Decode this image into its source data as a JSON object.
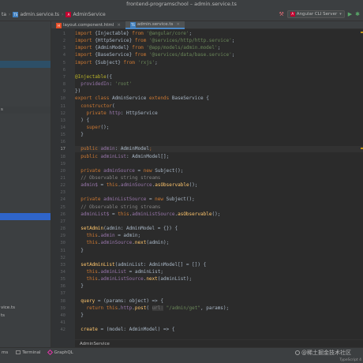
{
  "window_title": "frontend-programschool – admin.service.ts",
  "navbar": {
    "crumbs": [
      {
        "label": "ta",
        "icon": "none"
      },
      {
        "label": "admin.service.ts",
        "icon": "typescript-file-icon"
      },
      {
        "label": "AdminService",
        "icon": "angular-icon"
      }
    ],
    "run_config": "Angular CLI Server"
  },
  "project_rows": [
    {
      "label": "",
      "hl": ""
    },
    {
      "label": "",
      "hl": ""
    },
    {
      "label": "",
      "hl": ""
    },
    {
      "label": "",
      "hl": ""
    },
    {
      "label": "",
      "hl": ""
    },
    {
      "label": "",
      "hl": "hl1"
    },
    {
      "label": "",
      "hl": ""
    },
    {
      "label": "",
      "hl": ""
    },
    {
      "label": "",
      "hl": ""
    },
    {
      "label": "",
      "hl": ""
    },
    {
      "label": "",
      "hl": ""
    },
    {
      "label": "s",
      "hl": "hl3"
    },
    {
      "label": "",
      "hl": ""
    },
    {
      "label": "",
      "hl": ""
    },
    {
      "label": "",
      "hl": ""
    },
    {
      "label": "",
      "hl": ""
    },
    {
      "label": "",
      "hl": ""
    },
    {
      "label": "",
      "hl": ""
    },
    {
      "label": "",
      "hl": ""
    },
    {
      "label": "",
      "hl": ""
    },
    {
      "label": "",
      "hl": ""
    },
    {
      "label": "",
      "hl": ""
    },
    {
      "label": "",
      "hl": ""
    },
    {
      "label": "",
      "hl": ""
    },
    {
      "label": "",
      "hl": ""
    },
    {
      "label": "",
      "hl": "hl2"
    },
    {
      "label": "",
      "hl": ""
    },
    {
      "label": "",
      "hl": ""
    },
    {
      "label": "",
      "hl": ""
    },
    {
      "label": "",
      "hl": ""
    },
    {
      "label": "",
      "hl": ""
    },
    {
      "label": "",
      "hl": ""
    },
    {
      "label": "",
      "hl": ""
    },
    {
      "label": "",
      "hl": ""
    },
    {
      "label": "",
      "hl": ""
    },
    {
      "label": "",
      "hl": ""
    },
    {
      "label": "",
      "hl": ""
    },
    {
      "label": "vice.ts",
      "hl": ""
    },
    {
      "label": "ts",
      "hl": ""
    }
  ],
  "tabs": [
    {
      "label": "layout.component.html",
      "icon": "html-file-icon",
      "active": false
    },
    {
      "label": "admin.service.ts",
      "icon": "typescript-file-icon",
      "active": true
    }
  ],
  "code_lines": [
    {
      "n": "1",
      "t": [
        [
          "k",
          "import "
        ],
        [
          "p",
          "{"
        ],
        [
          "p",
          "Injectable"
        ],
        [
          "p",
          "} "
        ],
        [
          "k",
          "from "
        ],
        [
          "s",
          "'@angular/core'"
        ],
        [
          "p",
          ";"
        ]
      ]
    },
    {
      "n": "2",
      "t": [
        [
          "k",
          "import "
        ],
        [
          "p",
          "{HttpService} "
        ],
        [
          "k",
          "from "
        ],
        [
          "s",
          "'@services/http/http.service'"
        ],
        [
          "p",
          ";"
        ]
      ]
    },
    {
      "n": "3",
      "t": [
        [
          "k",
          "import "
        ],
        [
          "p",
          "{AdminModel} "
        ],
        [
          "k",
          "from "
        ],
        [
          "s",
          "'@app/models/admin.model'"
        ],
        [
          "p",
          ";"
        ]
      ]
    },
    {
      "n": "4",
      "t": [
        [
          "k",
          "import "
        ],
        [
          "p",
          "{BaseService} "
        ],
        [
          "k",
          "from "
        ],
        [
          "s",
          "'@services/data/base.service'"
        ],
        [
          "p",
          ";"
        ]
      ]
    },
    {
      "n": "5",
      "t": [
        [
          "k",
          "import "
        ],
        [
          "p",
          "{Subject} "
        ],
        [
          "k",
          "from "
        ],
        [
          "s",
          "'rxjs'"
        ],
        [
          "p",
          ";"
        ]
      ]
    },
    {
      "n": "6",
      "t": []
    },
    {
      "n": "7",
      "t": [
        [
          "a",
          "@Injectable"
        ],
        [
          "p",
          "({"
        ]
      ]
    },
    {
      "n": "8",
      "t": [
        [
          "p",
          "  "
        ],
        [
          "f",
          "providedIn"
        ],
        [
          "p",
          ": "
        ],
        [
          "s",
          "'root'"
        ]
      ]
    },
    {
      "n": "9",
      "t": [
        [
          "p",
          "})"
        ]
      ]
    },
    {
      "n": "10",
      "t": [
        [
          "k",
          "export class "
        ],
        [
          "p",
          "AdminService "
        ],
        [
          "k",
          "extends "
        ],
        [
          "p",
          "BaseService {"
        ]
      ]
    },
    {
      "n": "11",
      "t": [
        [
          "p",
          "  "
        ],
        [
          "k",
          "constructor"
        ],
        [
          "p",
          "("
        ]
      ]
    },
    {
      "n": "12",
      "t": [
        [
          "p",
          "    "
        ],
        [
          "k",
          "private "
        ],
        [
          "f",
          "http"
        ],
        [
          "p",
          ": HttpService"
        ]
      ]
    },
    {
      "n": "13",
      "t": [
        [
          "p",
          "  ) {"
        ]
      ]
    },
    {
      "n": "14",
      "t": [
        [
          "p",
          "    "
        ],
        [
          "k",
          "super"
        ],
        [
          "p",
          "();"
        ]
      ]
    },
    {
      "n": "15",
      "t": [
        [
          "p",
          "  }"
        ]
      ]
    },
    {
      "n": "16",
      "t": []
    },
    {
      "n": "17",
      "t": [
        [
          "p",
          "  "
        ],
        [
          "k",
          "public "
        ],
        [
          "f",
          "admin"
        ],
        [
          "p",
          ": AdminModel"
        ],
        [
          "k",
          ";"
        ]
      ],
      "cur": true
    },
    {
      "n": "18",
      "t": [
        [
          "p",
          "  "
        ],
        [
          "k",
          "public "
        ],
        [
          "f",
          "adminList"
        ],
        [
          "p",
          ": AdminModel[];"
        ]
      ]
    },
    {
      "n": "19",
      "t": []
    },
    {
      "n": "20",
      "t": [
        [
          "p",
          "  "
        ],
        [
          "k",
          "private "
        ],
        [
          "f",
          "adminSource"
        ],
        [
          "p",
          " = "
        ],
        [
          "k",
          "new "
        ],
        [
          "p",
          "Subject();"
        ]
      ]
    },
    {
      "n": "21",
      "t": [
        [
          "c",
          "  // Observable string streams"
        ]
      ]
    },
    {
      "n": "22",
      "t": [
        [
          "p",
          "  "
        ],
        [
          "f",
          "admin$"
        ],
        [
          "p",
          " = "
        ],
        [
          "k",
          "this"
        ],
        [
          "p",
          "."
        ],
        [
          "f",
          "adminSource"
        ],
        [
          "p",
          "."
        ],
        [
          "m",
          "asObservable"
        ],
        [
          "p",
          "();"
        ]
      ]
    },
    {
      "n": "23",
      "t": []
    },
    {
      "n": "24",
      "t": [
        [
          "p",
          "  "
        ],
        [
          "k",
          "private "
        ],
        [
          "f",
          "adminListSource"
        ],
        [
          "p",
          " = "
        ],
        [
          "k",
          "new "
        ],
        [
          "p",
          "Subject();"
        ]
      ]
    },
    {
      "n": "25",
      "t": [
        [
          "c",
          "  // Observable string streams"
        ]
      ]
    },
    {
      "n": "26",
      "t": [
        [
          "p",
          "  "
        ],
        [
          "f",
          "adminList$"
        ],
        [
          "p",
          " = "
        ],
        [
          "k",
          "this"
        ],
        [
          "p",
          "."
        ],
        [
          "f",
          "adminListSource"
        ],
        [
          "p",
          "."
        ],
        [
          "m",
          "asObservable"
        ],
        [
          "p",
          "();"
        ]
      ]
    },
    {
      "n": "27",
      "t": []
    },
    {
      "n": "28",
      "t": [
        [
          "p",
          "  "
        ],
        [
          "m",
          "setAdmin"
        ],
        [
          "p",
          "(admin: AdminModel = {}) {"
        ]
      ]
    },
    {
      "n": "29",
      "t": [
        [
          "p",
          "    "
        ],
        [
          "k",
          "this"
        ],
        [
          "p",
          "."
        ],
        [
          "f",
          "admin"
        ],
        [
          "p",
          " = admin;"
        ]
      ]
    },
    {
      "n": "30",
      "t": [
        [
          "p",
          "    "
        ],
        [
          "k",
          "this"
        ],
        [
          "p",
          "."
        ],
        [
          "f",
          "adminSource"
        ],
        [
          "p",
          "."
        ],
        [
          "m",
          "next"
        ],
        [
          "p",
          "(admin);"
        ]
      ]
    },
    {
      "n": "31",
      "t": [
        [
          "p",
          "  }"
        ]
      ]
    },
    {
      "n": "32",
      "t": []
    },
    {
      "n": "33",
      "t": [
        [
          "p",
          "  "
        ],
        [
          "m",
          "setAdminList"
        ],
        [
          "p",
          "(adminList: AdminModel[] = []) {"
        ]
      ]
    },
    {
      "n": "34",
      "t": [
        [
          "p",
          "    "
        ],
        [
          "k",
          "this"
        ],
        [
          "p",
          "."
        ],
        [
          "f",
          "adminList"
        ],
        [
          "p",
          " = adminList;"
        ]
      ]
    },
    {
      "n": "35",
      "t": [
        [
          "p",
          "    "
        ],
        [
          "k",
          "this"
        ],
        [
          "p",
          "."
        ],
        [
          "f",
          "adminListSource"
        ],
        [
          "p",
          "."
        ],
        [
          "m",
          "next"
        ],
        [
          "p",
          "(adminList);"
        ]
      ]
    },
    {
      "n": "36",
      "t": [
        [
          "p",
          "  }"
        ]
      ]
    },
    {
      "n": "37",
      "t": []
    },
    {
      "n": "38",
      "t": [
        [
          "p",
          "  "
        ],
        [
          "m",
          "query"
        ],
        [
          "p",
          " = (params: object) => {"
        ]
      ]
    },
    {
      "n": "39",
      "t": [
        [
          "p",
          "    "
        ],
        [
          "k",
          "return this"
        ],
        [
          "p",
          "."
        ],
        [
          "f",
          "http"
        ],
        [
          "p",
          "."
        ],
        [
          "m",
          "post"
        ],
        [
          "p",
          "( "
        ],
        [
          "hint",
          "url:"
        ],
        [
          "s",
          " \"/admin/get\""
        ],
        [
          "p",
          ", params);"
        ]
      ]
    },
    {
      "n": "40",
      "t": [
        [
          "p",
          "  }"
        ]
      ]
    },
    {
      "n": "41",
      "t": []
    },
    {
      "n": "42",
      "t": [
        [
          "p",
          "  "
        ],
        [
          "m",
          "create"
        ],
        [
          "p",
          " = (model: AdminModel) => {"
        ]
      ]
    }
  ],
  "editor_breadcrumb": "AdminService",
  "bottom_tools": [
    "ms",
    "Terminal",
    "GraphQL"
  ],
  "status_right": "TypeScript 4",
  "watermark": "@稀土掘金技术社区"
}
